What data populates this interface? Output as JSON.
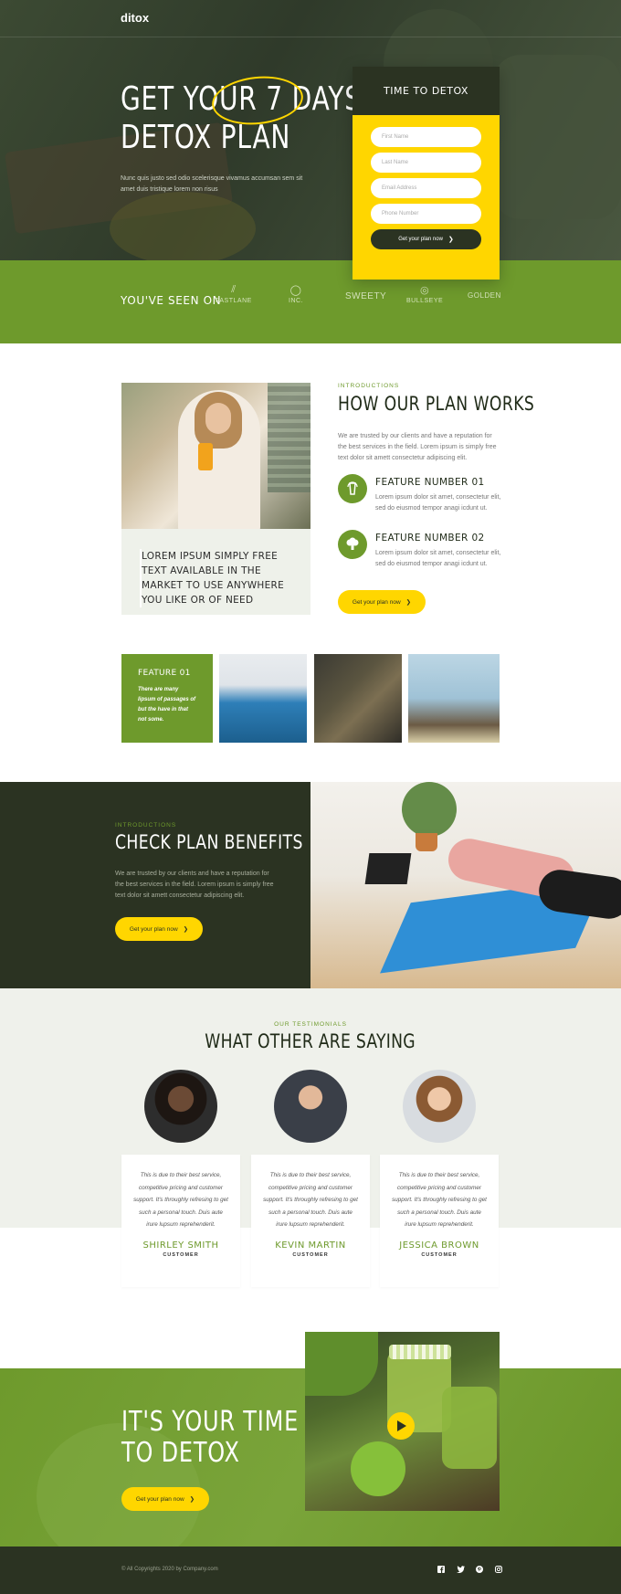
{
  "brand": {
    "logo": "ditox"
  },
  "hero": {
    "title_line1": "GET YOUR 7 DAYS",
    "title_line2": "DETOX PLAN",
    "text": "Nunc quis justo sed odio scelerisque vivamus accumsan sem sit amet duis tristique lorem non risus"
  },
  "form": {
    "heading": "TIME TO DETOX",
    "fields": [
      {
        "placeholder": "First Name"
      },
      {
        "placeholder": "Last Name"
      },
      {
        "placeholder": "Email Address"
      },
      {
        "placeholder": "Phone Number"
      }
    ],
    "button": "Get your plan now"
  },
  "seen_on": {
    "label": "YOU'VE SEEN ON",
    "brands": [
      "FASTLANE",
      "INC.",
      "SWEETY",
      "BULLSEYE",
      "GOLDEN"
    ]
  },
  "how": {
    "eyebrow": "INTRODUCTIONS",
    "title": "HOW OUR PLAN WORKS",
    "text": "We are trusted by our clients and have a reputation for the best services in the field. Lorem ipsum is simply free text dolor sit amett consectetur adipiscing elit.",
    "quote": "LOREM IPSUM SIMPLY FREE TEXT AVAILABLE IN THE MARKET TO USE ANYWHERE YOU LIKE OR OF NEED",
    "features": [
      {
        "title": "FEATURE NUMBER 01",
        "text": "Lorem ipsum dolor sit amet, consectetur elit, sed do eiusmod tempor anagi icdunt ut.",
        "icon": "refresh-drink-icon"
      },
      {
        "title": "FEATURE NUMBER 02",
        "text": "Lorem ipsum dolor sit amet, consectetur elit, sed do eiusmod tempor anagi icdunt ut.",
        "icon": "broccoli-icon"
      }
    ],
    "button": "Get your plan now"
  },
  "tiles": {
    "feature_title": "FEATURE 01",
    "feature_text": "There are many lipsum of passages of but the have in that not some."
  },
  "benefits": {
    "eyebrow": "INTRODUCTIONS",
    "title": "CHECK PLAN BENEFITS",
    "text": "We are trusted by our clients and have a reputation for the best services in the field. Lorem ipsum is simply free text dolor sit amett consectetur adipiscing elit.",
    "button": "Get your plan now"
  },
  "testimonials": {
    "eyebrow": "OUR TESTIMONIALS",
    "title": "WHAT OTHER ARE SAYING",
    "items": [
      {
        "quote": "This is due to their best service, competitive pricing and customer support. It's throughly refresing to get such a personal touch. Duis aute irure lupsum reprehenderit.",
        "name": "SHIRLEY SMITH",
        "role": "CUSTOMER"
      },
      {
        "quote": "This is due to their best service, competitive pricing and customer support. It's throughly refresing to get such a personal touch. Duis aute irure lupsum reprehenderit.",
        "name": "KEVIN MARTIN",
        "role": "CUSTOMER"
      },
      {
        "quote": "This is due to their best service, competitive pricing and customer support. It's throughly refresing to get such a personal touch. Duis aute irure lupsum reprehenderit.",
        "name": "JESSICA BROWN",
        "role": "CUSTOMER"
      }
    ]
  },
  "cta": {
    "title_line1": "IT'S YOUR TIME",
    "title_line2": "TO DETOX",
    "button": "Get your plan now"
  },
  "footer": {
    "copyright": "© All Copyrights 2020 by Company.com",
    "social": [
      "facebook-icon",
      "twitter-icon",
      "pinterest-icon",
      "instagram-icon"
    ]
  },
  "colors": {
    "accent_green": "#6e9a2c",
    "accent_yellow": "#ffd600",
    "dark": "#2b3322"
  }
}
